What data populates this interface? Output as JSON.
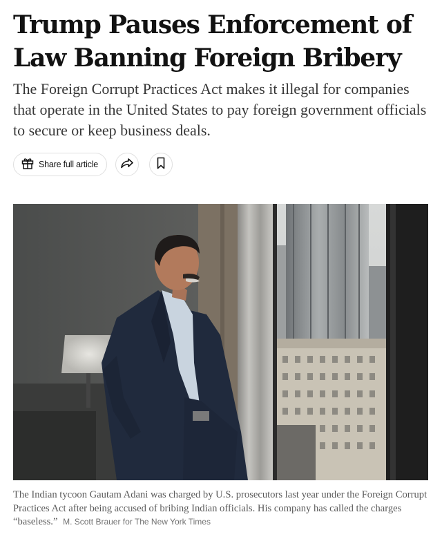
{
  "article": {
    "headline": "Trump Pauses Enforcement of Law Banning Foreign Bribery",
    "summary": "The Foreign Corrupt Practices Act makes it illegal for companies that operate in the United States to pay foreign government officials to secure or keep business deals."
  },
  "toolbar": {
    "share_full_label": "Share full article",
    "icons": {
      "share_full": "gift-icon",
      "share": "share-arrow-icon",
      "save": "bookmark-icon"
    }
  },
  "photo": {
    "caption": "The Indian tycoon Gautam Adani was charged by U.S. prosecutors last year under the Foreign Corrupt Practices Act after being accused of bribing Indian officials. His company has called the charges “baseless.”",
    "credit": "M. Scott Brauer for The New York Times"
  },
  "colors": {
    "text": "#121212",
    "summary": "#363636",
    "caption": "#5a5a5a",
    "border": "#dfdfdf"
  }
}
